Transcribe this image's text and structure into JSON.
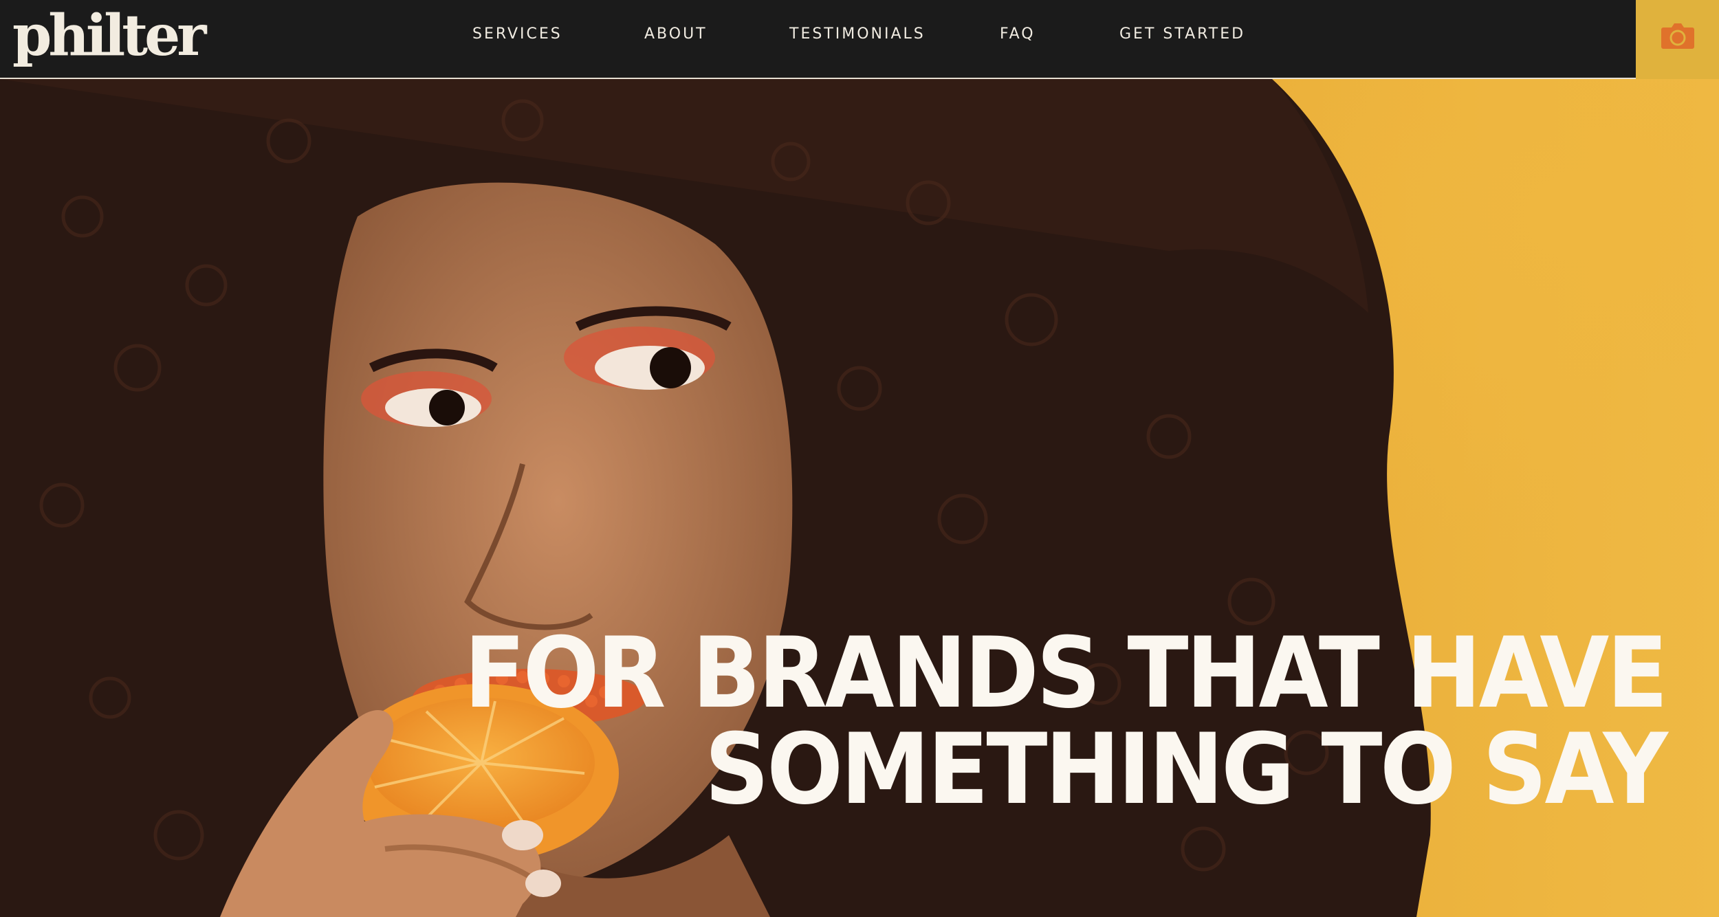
{
  "brand": {
    "logo_text": "philter"
  },
  "nav": {
    "items": [
      {
        "label": "SERVICES"
      },
      {
        "label": "ABOUT"
      },
      {
        "label": "TESTIMONIALS"
      },
      {
        "label": "FAQ"
      },
      {
        "label": "GET STARTED"
      }
    ],
    "camera_button_icon": "camera-icon"
  },
  "hero": {
    "headline_line1": "FOR BRANDS THAT HAVE",
    "headline_line2": "SOMETHING TO SAY"
  },
  "colors": {
    "nav_background": "#1b1b1b",
    "nav_text": "#f1ece2",
    "accent_yellow": "#e0b23d",
    "camera_icon": "#e0722b",
    "hero_background": "#eaae38",
    "headline_text": "#fbf7f0"
  }
}
